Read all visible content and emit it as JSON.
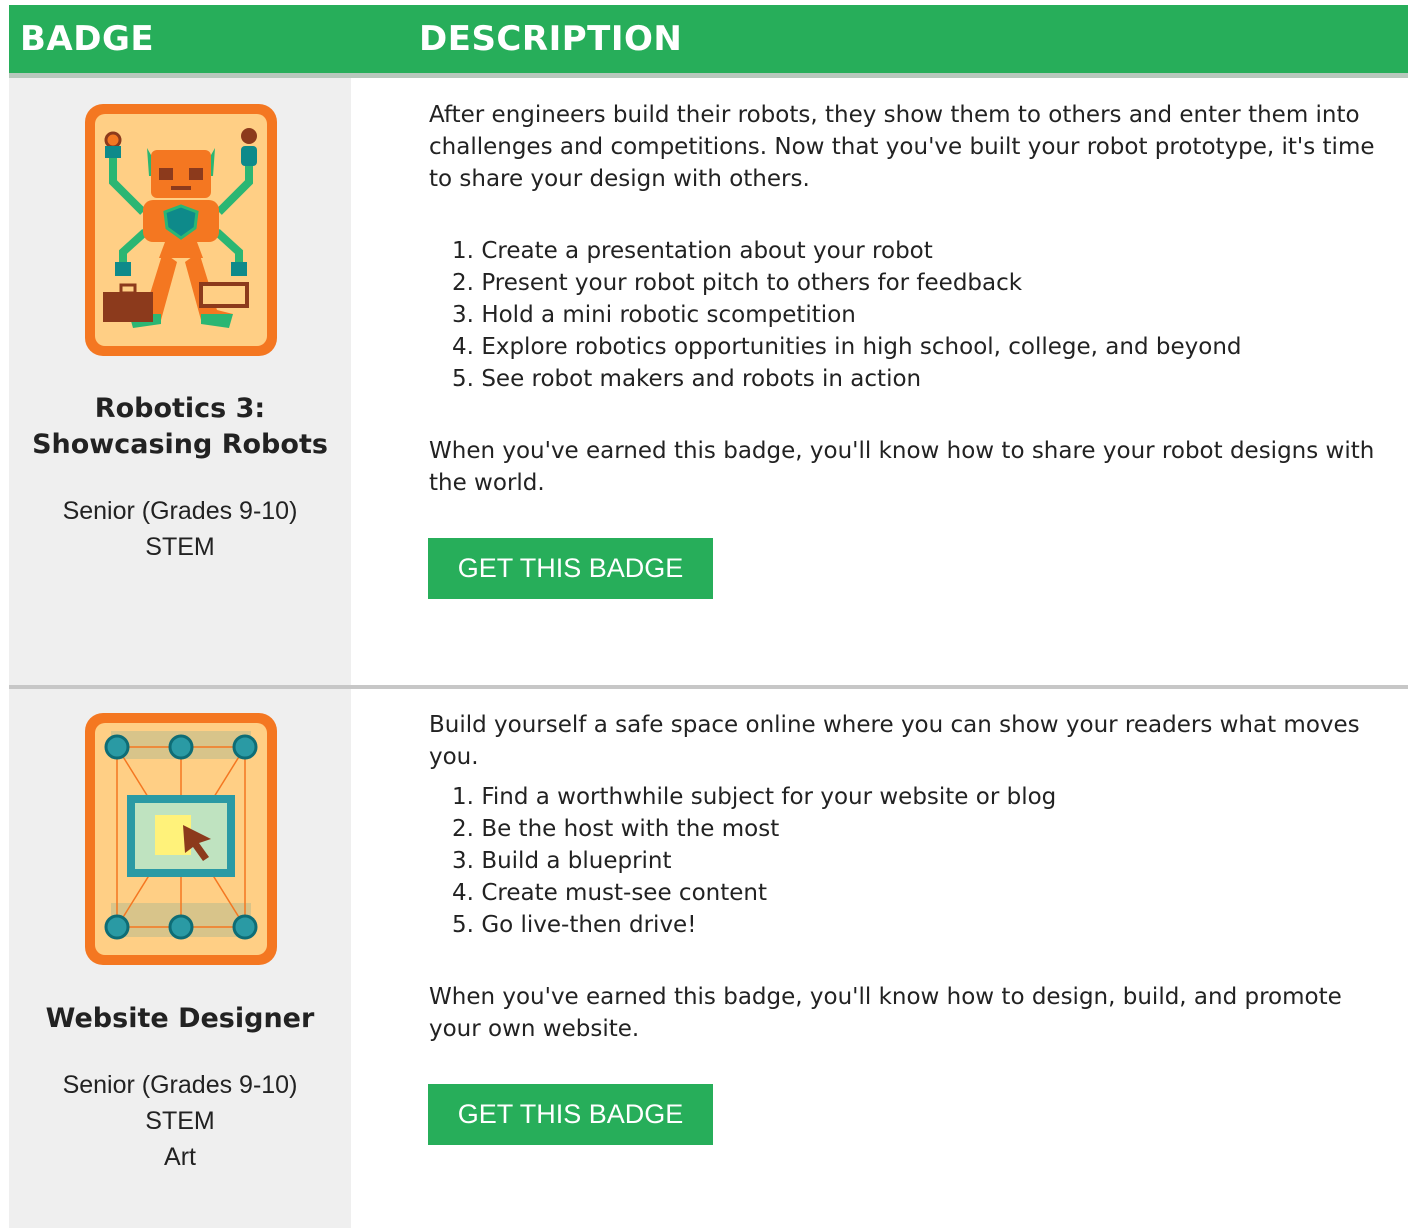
{
  "header": {
    "badge_col": "BADGE",
    "description_col": "DESCRIPTION"
  },
  "colors": {
    "accent_green": "#27ae5a",
    "patch_orange": "#f47721",
    "patch_fill": "#ffcf85"
  },
  "badges": [
    {
      "icon": "robot-badge-icon",
      "title_line1": "Robotics 3:",
      "title_line2": "Showcasing Robots",
      "level": "Senior (Grades 9-10)",
      "categories": [
        "STEM"
      ],
      "intro": "After engineers build their robots, they show them to others and enter them into challenges and competitions. Now that you've built your robot prototype, it's time to share your design with others.",
      "steps": [
        {
          "num": "1.",
          "text": "Create a presentation about your robot"
        },
        {
          "num": "2.",
          "text": "Present your robot pitch to others for feedback"
        },
        {
          "num": "3.",
          "text": "Hold a mini robotic scompetition"
        },
        {
          "num": "4.",
          "text": "Explore robotics opportunities in high school, college, and beyond"
        },
        {
          "num": "5.",
          "text": "See robot makers and robots in action"
        }
      ],
      "outcome": "When you've earned this badge, you'll know how to share your robot designs with the world.",
      "button_label": "GET THIS BADGE"
    },
    {
      "icon": "website-badge-icon",
      "title_line1": "Website Designer",
      "level": "Senior (Grades 9-10)",
      "categories": [
        "STEM",
        "Art"
      ],
      "intro": "Build yourself a safe space online where you can show your readers what moves you.",
      "steps": [
        {
          "num": "1.",
          "text": "Find a worthwhile subject for your website or blog"
        },
        {
          "num": "2.",
          "text": "Be the host with the most"
        },
        {
          "num": "3.",
          "text": "Build a blueprint"
        },
        {
          "num": "4.",
          "text": "Create must-see content"
        },
        {
          "num": "5.",
          "text": "Go live-then drive!"
        }
      ],
      "outcome": "When you've earned this badge, you'll know how to design, build, and promote your own website.",
      "button_label": "GET THIS BADGE"
    }
  ]
}
